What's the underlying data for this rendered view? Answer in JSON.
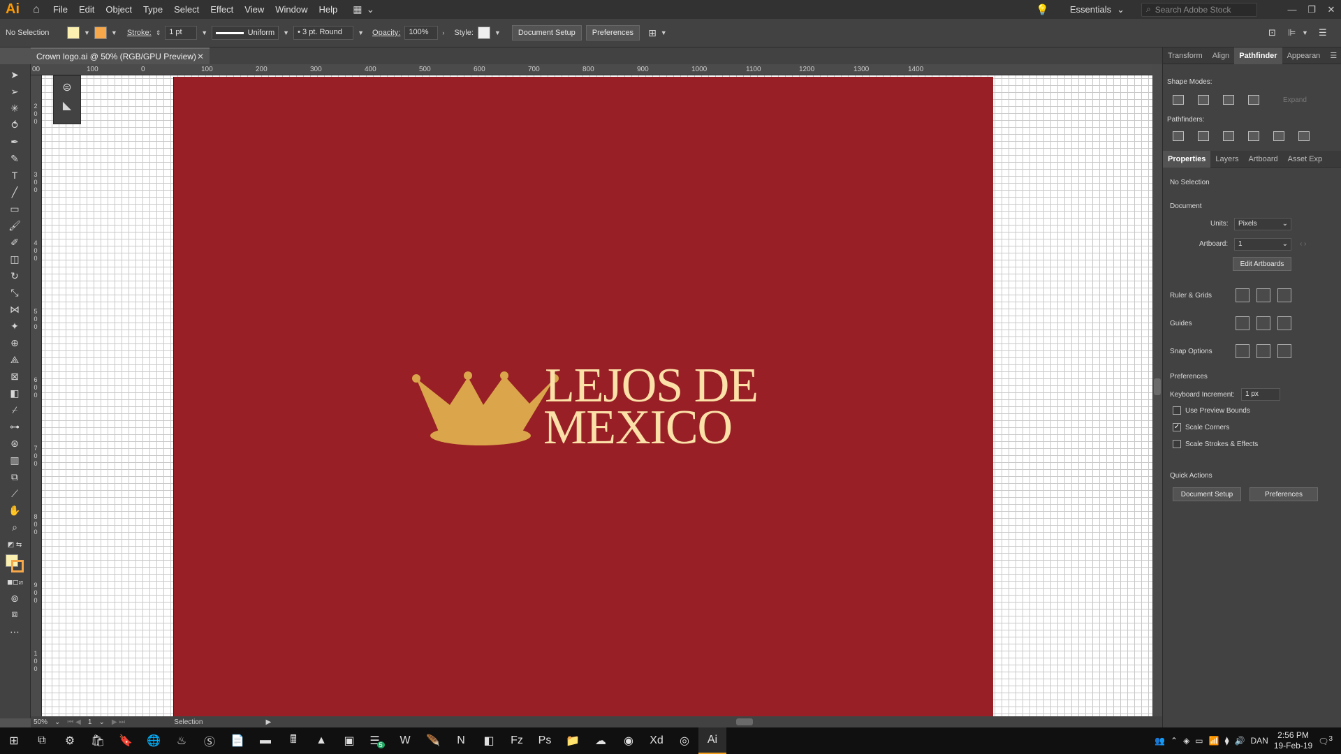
{
  "app": {
    "logo": "Ai",
    "name": "Adobe Illustrator"
  },
  "menu": [
    "File",
    "Edit",
    "Object",
    "Type",
    "Select",
    "Effect",
    "View",
    "Window",
    "Help"
  ],
  "topright": {
    "workspace": "Essentials",
    "search_placeholder": "Search Adobe Stock"
  },
  "controlbar": {
    "selection": "No Selection",
    "stroke_label": "Stroke:",
    "stroke_weight": "1 pt",
    "profile": "Uniform",
    "brush": "3 pt. Round",
    "opacity_label": "Opacity:",
    "opacity": "100%",
    "style_label": "Style:",
    "document_setup": "Document Setup",
    "preferences": "Preferences",
    "fill_color": "#fbf0b0",
    "stroke_color": "#f6a84a"
  },
  "document": {
    "tab_title": "Crown logo.ai @ 50% (RGB/GPU Preview)"
  },
  "ruler": {
    "top": [
      "00",
      "100",
      "0",
      "100",
      "200",
      "300",
      "400",
      "500",
      "600",
      "700",
      "800",
      "900",
      "1000",
      "1100",
      "1200",
      "1300",
      "1400"
    ],
    "left": [
      "2",
      "0",
      "0",
      "3",
      "0",
      "0",
      "4",
      "0",
      "0",
      "5",
      "0",
      "0",
      "6",
      "0",
      "0",
      "7",
      "0",
      "0",
      "8",
      "0",
      "0",
      "9",
      "0",
      "0",
      "1",
      "0",
      "0",
      "0"
    ]
  },
  "artboard": {
    "background": "#981f25",
    "logo_line1": "LEJOS DE",
    "logo_line2": "MEXICO",
    "crown_color": "#dba64b",
    "text_color": "#fbe0a8"
  },
  "status": {
    "zoom": "50%",
    "artboard_num": "1",
    "tool": "Selection"
  },
  "panels": {
    "top_tabs": [
      "Transform",
      "Align",
      "Pathfinder",
      "Appearan"
    ],
    "active_top_tab": "Pathfinder",
    "shape_modes": "Shape Modes:",
    "expand": "Expand",
    "pathfinders": "Pathfinders:",
    "lower_tabs": [
      "Properties",
      "Layers",
      "Artboard",
      "Asset Exp"
    ],
    "active_lower_tab": "Properties",
    "no_selection": "No Selection",
    "document": "Document",
    "units_label": "Units:",
    "units": "Pixels",
    "artboard_label": "Artboard:",
    "artboard_value": "1",
    "edit_artboards": "Edit Artboards",
    "ruler_grids": "Ruler & Grids",
    "guides": "Guides",
    "snap_options": "Snap Options",
    "preferences": "Preferences",
    "keyboard_increment_label": "Keyboard Increment:",
    "keyboard_increment": "1 px",
    "use_preview_bounds": "Use Preview Bounds",
    "scale_corners": "Scale Corners",
    "scale_strokes": "Scale Strokes & Effects",
    "quick_actions": "Quick Actions",
    "qa_document_setup": "Document Setup",
    "qa_preferences": "Preferences"
  },
  "taskbar": {
    "time": "2:56 PM",
    "date": "19-Feb-19",
    "lang": "DAN",
    "badge": "5",
    "notif": "3"
  }
}
